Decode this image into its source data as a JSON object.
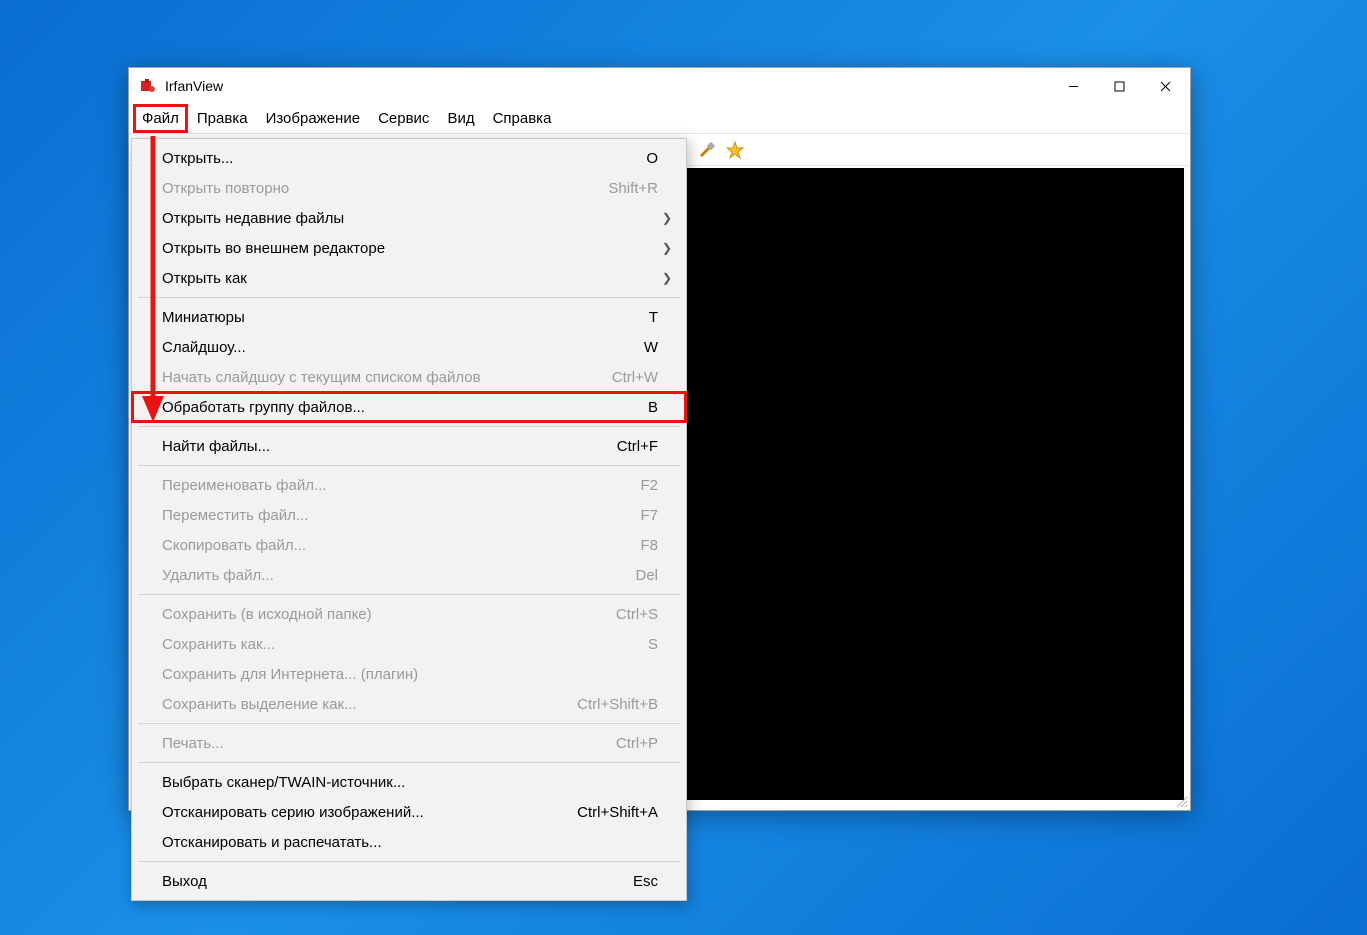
{
  "window": {
    "title": "IrfanView"
  },
  "menubar": {
    "items": [
      "Файл",
      "Правка",
      "Изображение",
      "Сервис",
      "Вид",
      "Справка"
    ],
    "active_index": 0
  },
  "toolbar_icons": [
    "open-icon",
    "thumbnails-icon",
    "slideshow-icon",
    "save-icon",
    "delete-icon",
    "cut-icon",
    "copy-icon",
    "paste-icon",
    "undo-icon",
    "image-info-icon",
    "zoom-in-icon",
    "zoom-out-icon",
    "prev-file-icon",
    "next-dir-icon",
    "first-icon",
    "last-icon",
    "prev-arrow-icon",
    "next-arrow-icon",
    "up-arrow-icon",
    "down-arrow-icon",
    "settings-icon",
    "about-icon"
  ],
  "file_menu": [
    {
      "label": "Открыть...",
      "shortcut": "O",
      "enabled": true
    },
    {
      "label": "Открыть повторно",
      "shortcut": "Shift+R",
      "enabled": false
    },
    {
      "label": "Открыть недавние файлы",
      "sub": true,
      "enabled": true
    },
    {
      "label": "Открыть во внешнем редакторе",
      "sub": true,
      "enabled": true
    },
    {
      "label": "Открыть как",
      "sub": true,
      "enabled": true
    },
    {
      "sep": true
    },
    {
      "label": "Миниатюры",
      "shortcut": "T",
      "enabled": true
    },
    {
      "label": "Слайдшоу...",
      "shortcut": "W",
      "enabled": true
    },
    {
      "label": "Начать слайдшоу с текущим списком файлов",
      "shortcut": "Ctrl+W",
      "enabled": false
    },
    {
      "label": "Обработать группу файлов...",
      "shortcut": "B",
      "enabled": true,
      "boxed": true
    },
    {
      "sep": true
    },
    {
      "label": "Найти файлы...",
      "shortcut": "Ctrl+F",
      "enabled": true
    },
    {
      "sep": true
    },
    {
      "label": "Переименовать файл...",
      "shortcut": "F2",
      "enabled": false
    },
    {
      "label": "Переместить файл...",
      "shortcut": "F7",
      "enabled": false
    },
    {
      "label": "Скопировать файл...",
      "shortcut": "F8",
      "enabled": false
    },
    {
      "label": "Удалить файл...",
      "shortcut": "Del",
      "enabled": false
    },
    {
      "sep": true
    },
    {
      "label": "Сохранить (в исходной папке)",
      "shortcut": "Ctrl+S",
      "enabled": false
    },
    {
      "label": "Сохранить как...",
      "shortcut": "S",
      "enabled": false
    },
    {
      "label": "Сохранить для Интернета... (плагин)",
      "enabled": false
    },
    {
      "label": "Сохранить выделение как...",
      "shortcut": "Ctrl+Shift+B",
      "enabled": false
    },
    {
      "sep": true
    },
    {
      "label": "Печать...",
      "shortcut": "Ctrl+P",
      "enabled": false
    },
    {
      "sep": true
    },
    {
      "label": "Выбрать сканер/TWAIN-источник...",
      "enabled": true
    },
    {
      "label": "Отсканировать серию изображений...",
      "shortcut": "Ctrl+Shift+A",
      "enabled": true
    },
    {
      "label": "Отсканировать и распечатать...",
      "enabled": true
    },
    {
      "sep": true
    },
    {
      "label": "Выход",
      "shortcut": "Esc",
      "enabled": true
    }
  ]
}
